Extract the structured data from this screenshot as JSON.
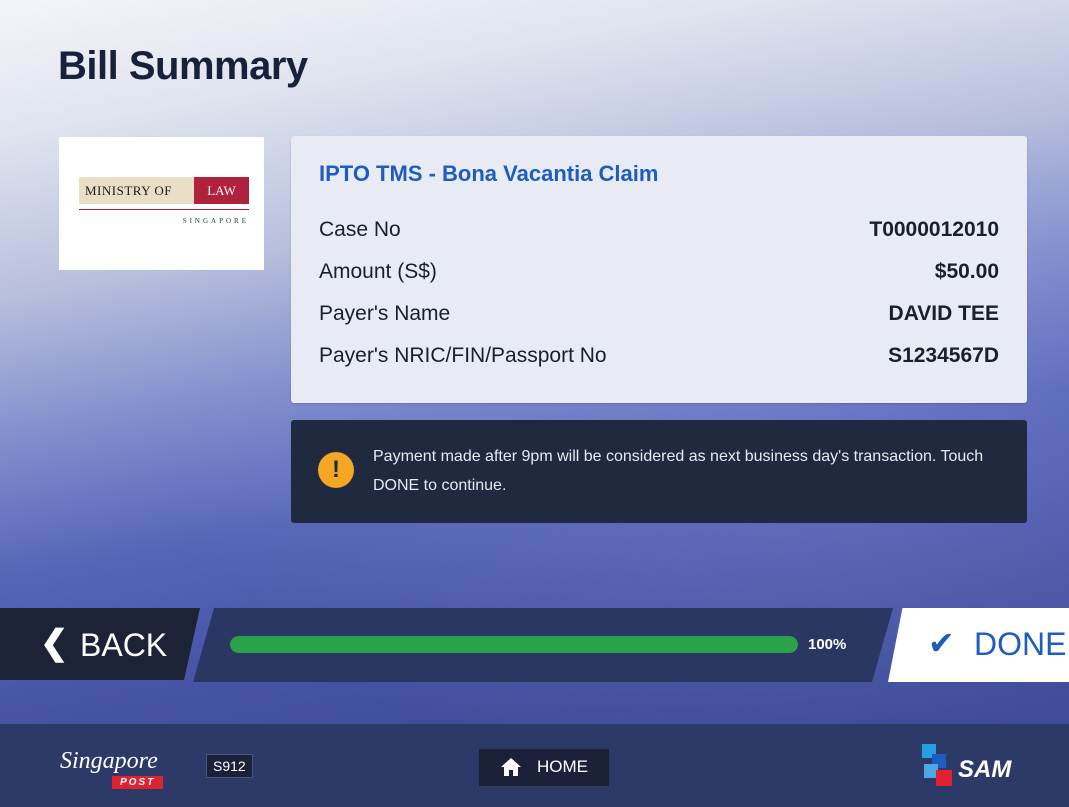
{
  "page": {
    "title": "Bill Summary"
  },
  "logo": {
    "line1": "MINISTRY OF",
    "line2": "LAW",
    "subtitle": "SINGAPORE"
  },
  "bill": {
    "title": "IPTO TMS - Bona Vacantia Claim",
    "rows": [
      {
        "label": "Case No",
        "value": "T0000012010"
      },
      {
        "label": "Amount (S$)",
        "value": "$50.00"
      },
      {
        "label": "Payer's Name",
        "value": "DAVID TEE"
      },
      {
        "label": "Payer's NRIC/FIN/Passport No",
        "value": "S1234567D"
      }
    ]
  },
  "notice": {
    "icon": "warning-icon",
    "text": "Payment made after 9pm will be considered as next business day's transaction. Touch DONE to continue."
  },
  "nav": {
    "back_label": "BACK",
    "done_label": "DONE",
    "progress_fraction": 1.0,
    "progress_label": "100%"
  },
  "footer": {
    "brand": "Singapore",
    "brand_sub": "POST",
    "kiosk_id": "S912",
    "home_label": "HOME",
    "sam_label": "SAM"
  },
  "colors": {
    "accent_blue": "#1d5dbf",
    "progress_green": "#2aa24a",
    "warning": "#f5a623",
    "notice_bg": "#1f2940"
  }
}
